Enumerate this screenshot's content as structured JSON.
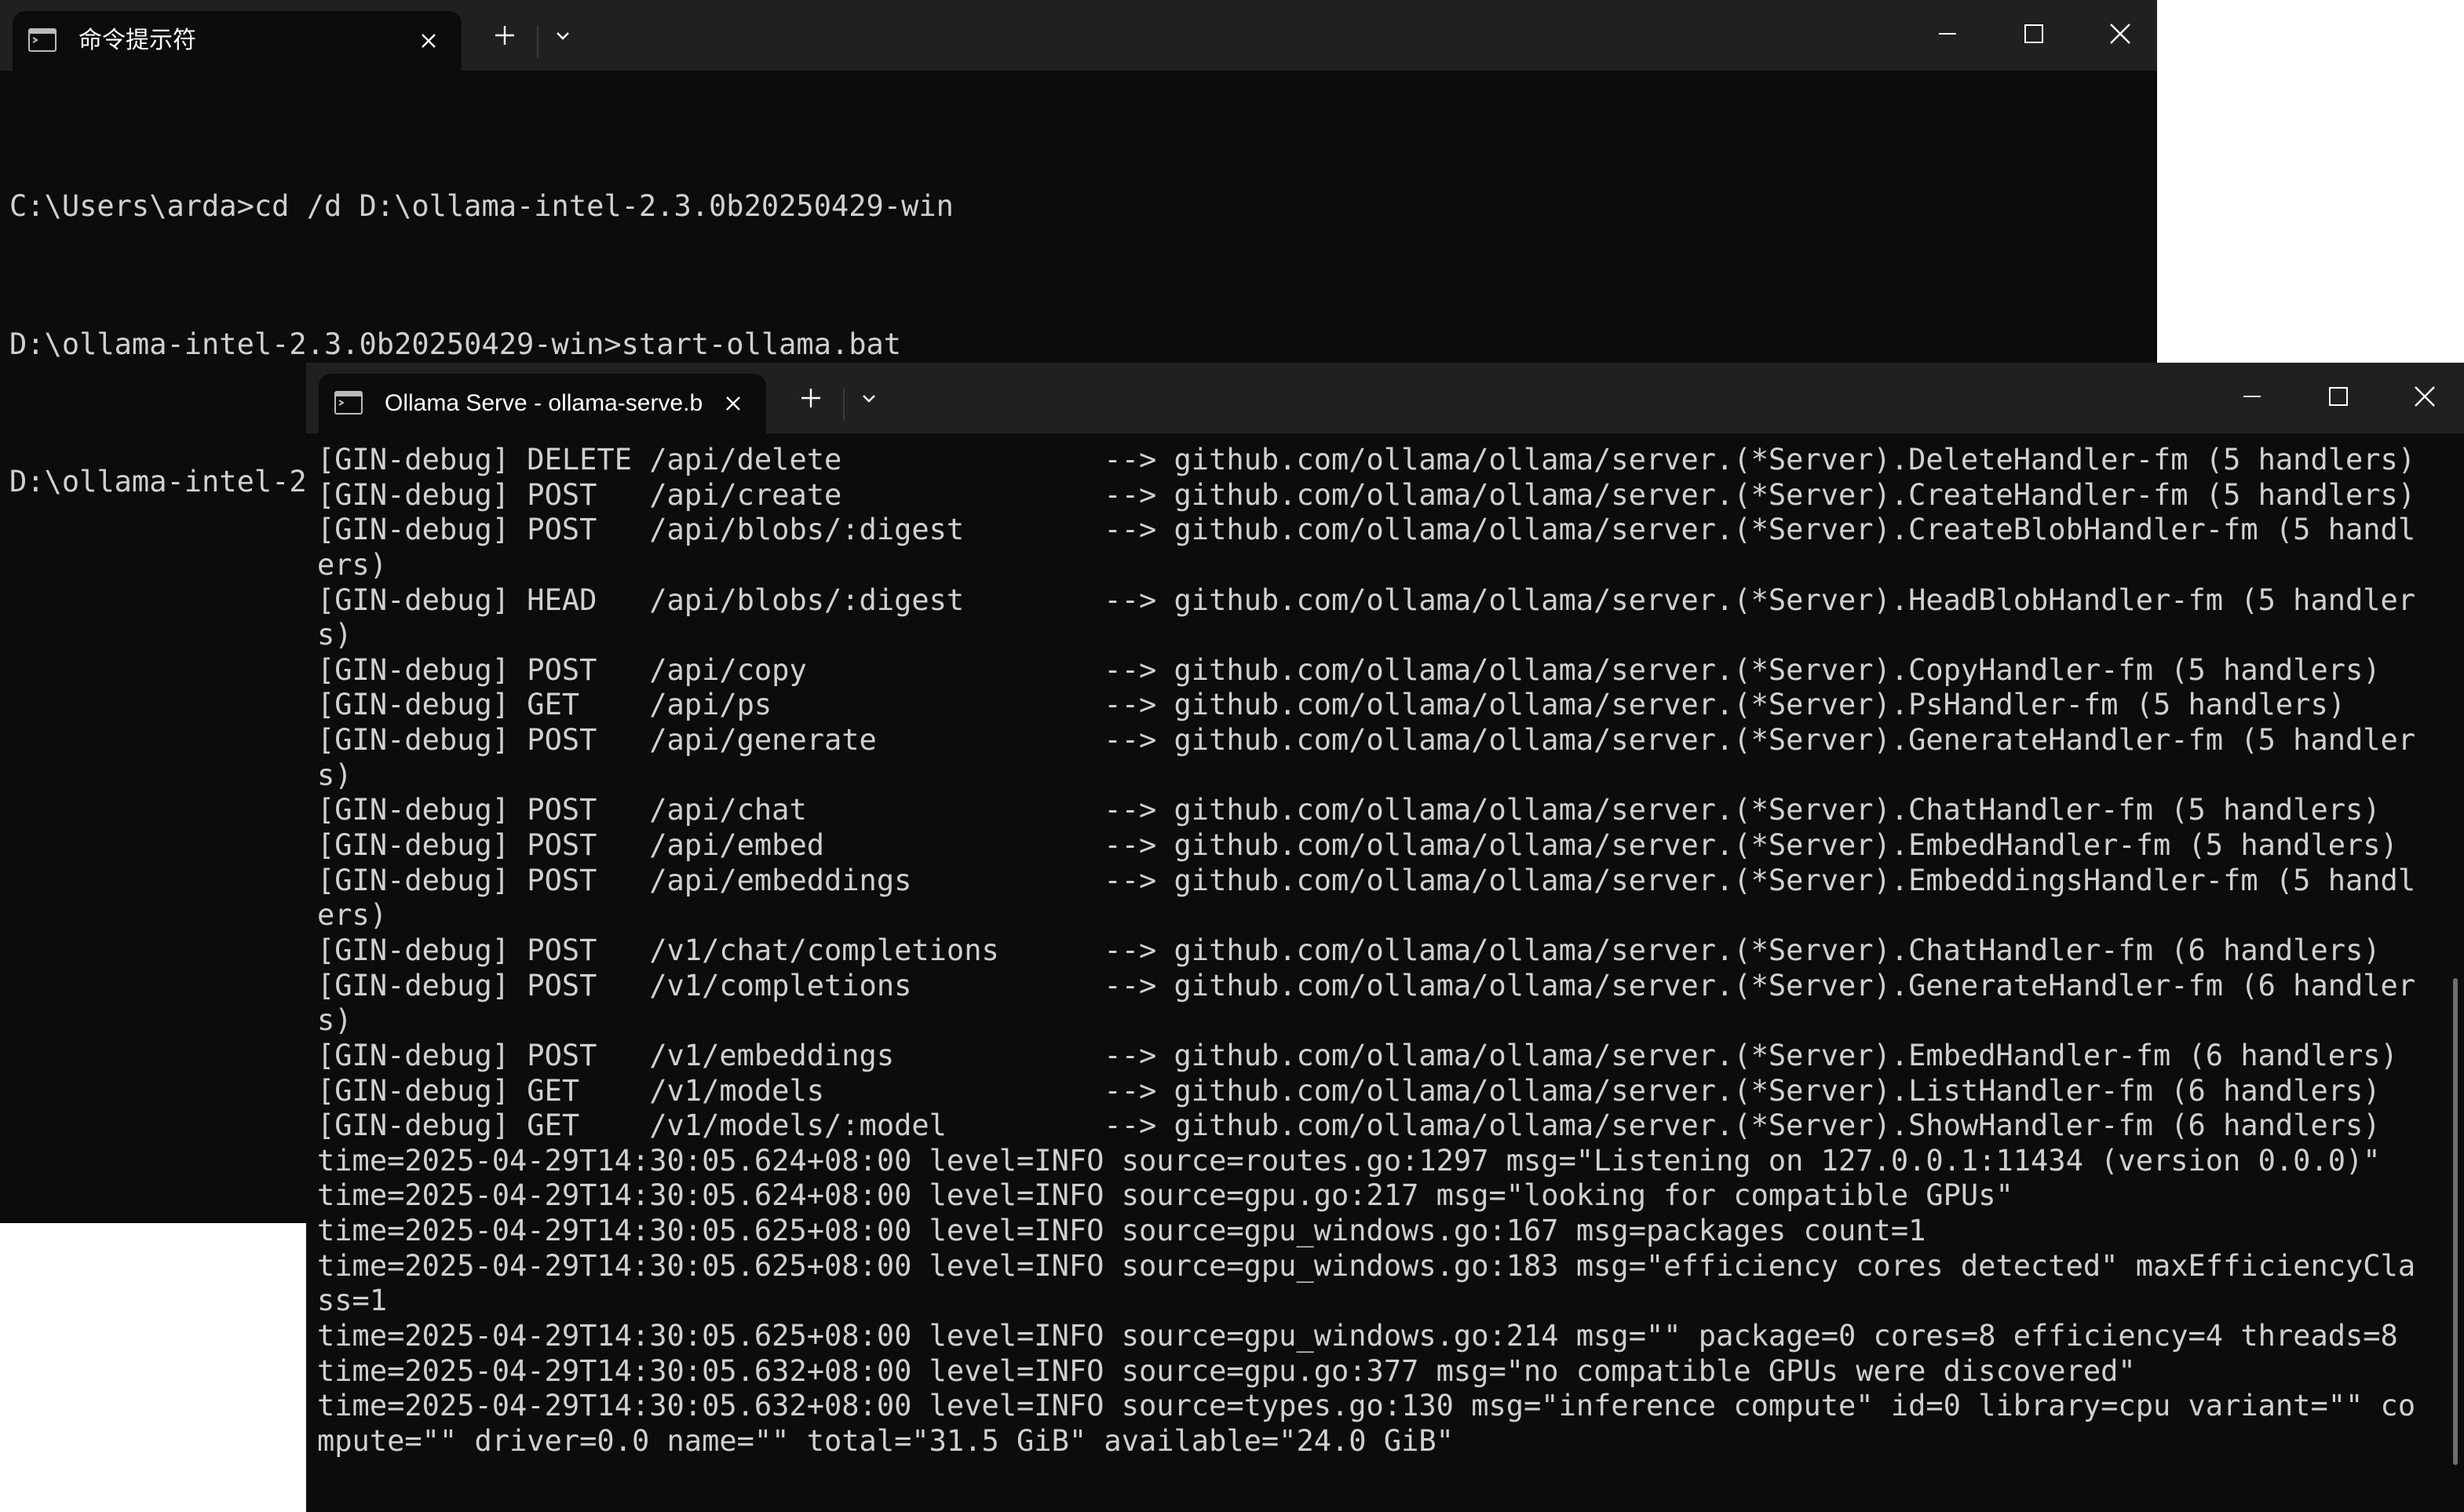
{
  "window_back": {
    "tab_title": "命令提示符",
    "lines": [
      "C:\\Users\\arda>cd /d D:\\ollama-intel-2.3.0b20250429-win",
      "D:\\ollama-intel-2.3.0b20250429-win>start-ollama.bat",
      "D:\\ollama-intel-2.3.0b20250429-win>"
    ]
  },
  "window_front": {
    "tab_title": "Ollama Serve - ollama-serve.b",
    "lines": [
      "[GIN-debug] DELETE /api/delete               --> github.com/ollama/ollama/server.(*Server).DeleteHandler-fm (5 handlers)",
      "[GIN-debug] POST   /api/create               --> github.com/ollama/ollama/server.(*Server).CreateHandler-fm (5 handlers)",
      "[GIN-debug] POST   /api/blobs/:digest        --> github.com/ollama/ollama/server.(*Server).CreateBlobHandler-fm (5 handl",
      "ers)",
      "[GIN-debug] HEAD   /api/blobs/:digest        --> github.com/ollama/ollama/server.(*Server).HeadBlobHandler-fm (5 handler",
      "s)",
      "[GIN-debug] POST   /api/copy                 --> github.com/ollama/ollama/server.(*Server).CopyHandler-fm (5 handlers)",
      "[GIN-debug] GET    /api/ps                   --> github.com/ollama/ollama/server.(*Server).PsHandler-fm (5 handlers)",
      "[GIN-debug] POST   /api/generate             --> github.com/ollama/ollama/server.(*Server).GenerateHandler-fm (5 handler",
      "s)",
      "[GIN-debug] POST   /api/chat                 --> github.com/ollama/ollama/server.(*Server).ChatHandler-fm (5 handlers)",
      "[GIN-debug] POST   /api/embed                --> github.com/ollama/ollama/server.(*Server).EmbedHandler-fm (5 handlers)",
      "[GIN-debug] POST   /api/embeddings           --> github.com/ollama/ollama/server.(*Server).EmbeddingsHandler-fm (5 handl",
      "ers)",
      "[GIN-debug] POST   /v1/chat/completions      --> github.com/ollama/ollama/server.(*Server).ChatHandler-fm (6 handlers)",
      "[GIN-debug] POST   /v1/completions           --> github.com/ollama/ollama/server.(*Server).GenerateHandler-fm (6 handler",
      "s)",
      "[GIN-debug] POST   /v1/embeddings            --> github.com/ollama/ollama/server.(*Server).EmbedHandler-fm (6 handlers)",
      "[GIN-debug] GET    /v1/models                --> github.com/ollama/ollama/server.(*Server).ListHandler-fm (6 handlers)",
      "[GIN-debug] GET    /v1/models/:model         --> github.com/ollama/ollama/server.(*Server).ShowHandler-fm (6 handlers)",
      "time=2025-04-29T14:30:05.624+08:00 level=INFO source=routes.go:1297 msg=\"Listening on 127.0.0.1:11434 (version 0.0.0)\"",
      "time=2025-04-29T14:30:05.624+08:00 level=INFO source=gpu.go:217 msg=\"looking for compatible GPUs\"",
      "time=2025-04-29T14:30:05.625+08:00 level=INFO source=gpu_windows.go:167 msg=packages count=1",
      "time=2025-04-29T14:30:05.625+08:00 level=INFO source=gpu_windows.go:183 msg=\"efficiency cores detected\" maxEfficiencyCla",
      "ss=1",
      "time=2025-04-29T14:30:05.625+08:00 level=INFO source=gpu_windows.go:214 msg=\"\" package=0 cores=8 efficiency=4 threads=8",
      "time=2025-04-29T14:30:05.632+08:00 level=INFO source=gpu.go:377 msg=\"no compatible GPUs were discovered\"",
      "time=2025-04-29T14:30:05.632+08:00 level=INFO source=types.go:130 msg=\"inference compute\" id=0 library=cpu variant=\"\" co",
      "mpute=\"\" driver=0.0 name=\"\" total=\"31.5 GiB\" available=\"24.0 GiB\""
    ]
  }
}
